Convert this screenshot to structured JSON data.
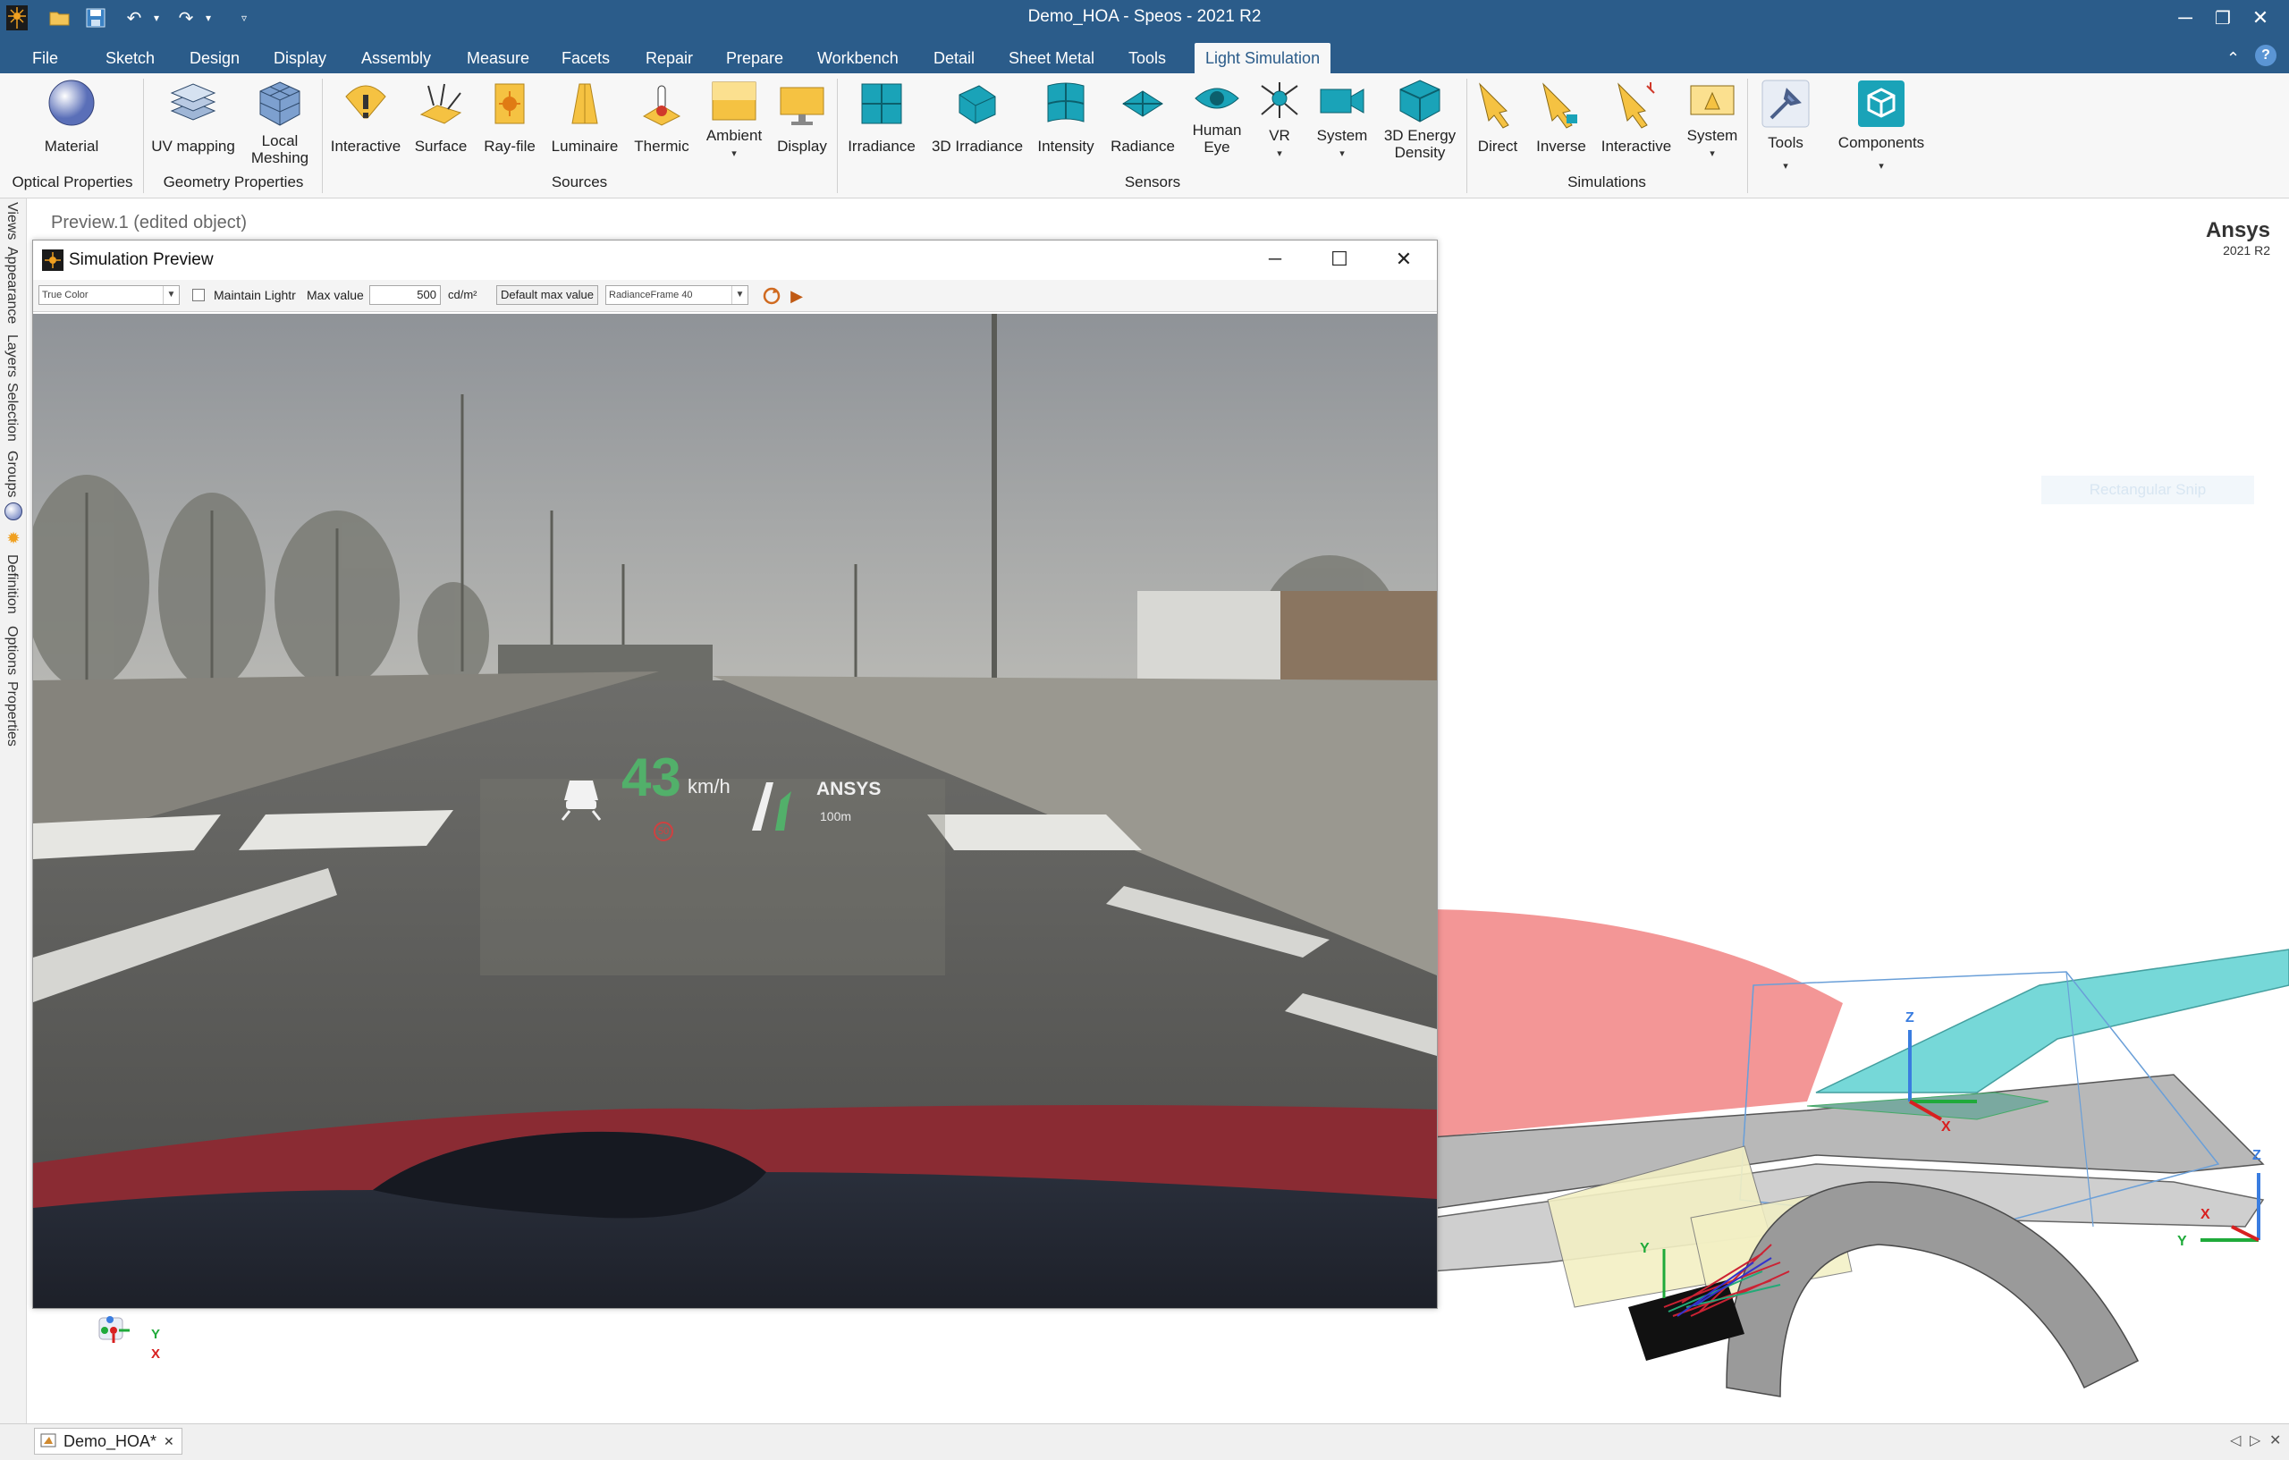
{
  "window": {
    "title": "Demo_HOA - Speos - 2021 R2",
    "minimize": "─",
    "restore": "❐",
    "close": "✕"
  },
  "quick_access": {
    "undo_arrow": "▾",
    "redo_arrow": "▾",
    "customize": "▿"
  },
  "menu": {
    "file": "File",
    "sketch": "Sketch",
    "design": "Design",
    "display": "Display",
    "assembly": "Assembly",
    "measure": "Measure",
    "facets": "Facets",
    "repair": "Repair",
    "prepare": "Prepare",
    "workbench": "Workbench",
    "detail": "Detail",
    "sheet_metal": "Sheet Metal",
    "tools": "Tools",
    "light_simulation": "Light Simulation",
    "collapse": "⌃",
    "help": "?"
  },
  "ribbon": {
    "material": "Material",
    "uv_mapping": "UV mapping",
    "local_meshing_1": "Local",
    "local_meshing_2": "Meshing",
    "interactive_src": "Interactive",
    "surface": "Surface",
    "ray_file": "Ray-file",
    "luminaire": "Luminaire",
    "thermic": "Thermic",
    "ambient": "Ambient",
    "display": "Display",
    "irradiance": "Irradiance",
    "irradiance_3d": "3D Irradiance",
    "intensity": "Intensity",
    "radiance": "Radiance",
    "human_eye_1": "Human",
    "human_eye_2": "Eye",
    "vr": "VR",
    "system_sensor": "System",
    "energy_1": "3D Energy",
    "energy_2": "Density",
    "direct": "Direct",
    "inverse": "Inverse",
    "interactive_sim": "Interactive",
    "system_sim": "System",
    "tools": "Tools",
    "components": "Components",
    "dropdown": "▾"
  },
  "groups": {
    "optical": "Optical Properties",
    "geometry": "Geometry Properties",
    "sources": "Sources",
    "sensors": "Sensors",
    "simulations": "Simulations"
  },
  "side_tabs": {
    "views": "Views",
    "appearance": "Appearance",
    "layers": "Layers",
    "selection": "Selection",
    "groups": "Groups",
    "definition": "Definition",
    "options": "Options",
    "properties": "Properties"
  },
  "viewport": {
    "doc_title": "Preview.1 (edited object)",
    "brand": "Ansys",
    "brand_version": "2021 R2",
    "snip_hint": "Rectangular Snip"
  },
  "preview": {
    "title": "Simulation Preview",
    "color_mode": "True Color",
    "maintain_label": "Maintain Lightr",
    "max_value_label": "Max value",
    "max_value": "500",
    "unit": "cd/m²",
    "default_max_button": "Default max value",
    "frame_select": "RadianceFrame 40",
    "minimize": "─",
    "maximize": "☐",
    "close": "✕"
  },
  "hud": {
    "speed": "43",
    "speed_unit": "km/h",
    "brand": "ANSYS",
    "distance": "100m",
    "limit": "50"
  },
  "axes": {
    "z": "Z",
    "y": "Y",
    "x": "X"
  },
  "bottom": {
    "doc_tab": "Demo_HOA*",
    "doc_close": "✕",
    "nav_prev": "◁",
    "nav_next": "▷",
    "nav_close": "✕"
  },
  "colors": {
    "title_blue": "#2b5c8a",
    "ribbon_bg": "#f7f7f7",
    "sensor_teal": "#1aa3b8",
    "source_yellow": "#f5c242"
  }
}
